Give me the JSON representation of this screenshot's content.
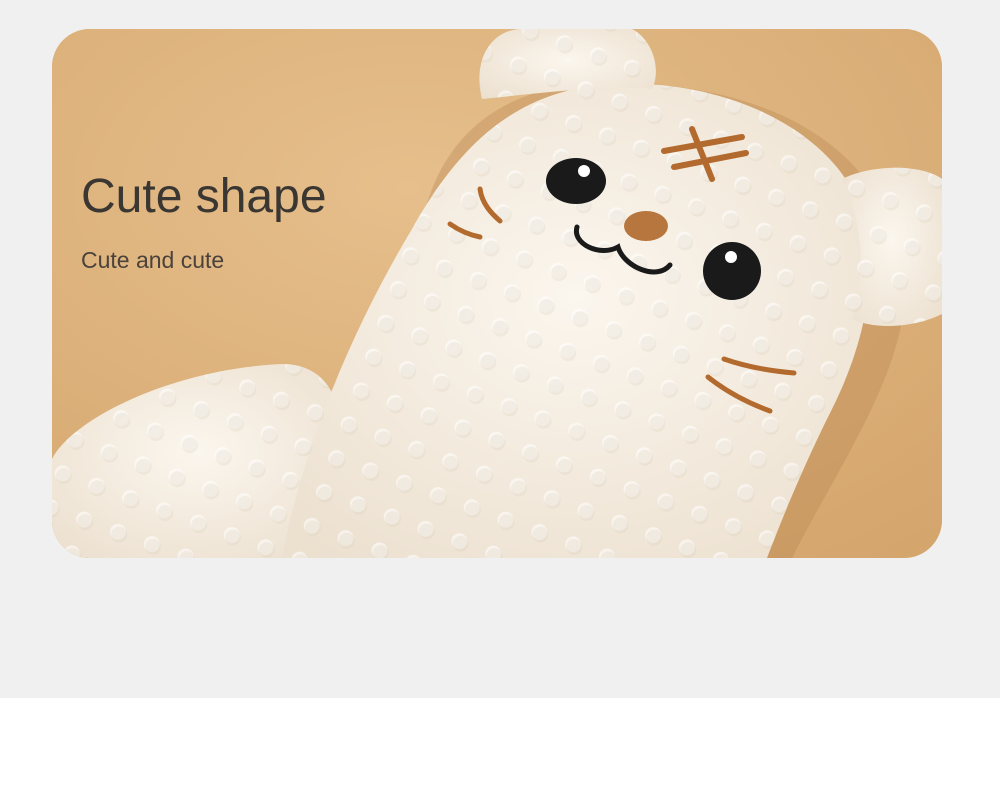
{
  "feature": {
    "title": "Cute shape",
    "subtitle": "Cute and cute"
  },
  "photo": {
    "subject": "plush-cat-pillow",
    "colors": {
      "background": "#ddb27b",
      "plush": "#f7efe4",
      "embroidery_brown": "#b36a2e",
      "embroidery_black": "#1a1a1a"
    }
  }
}
